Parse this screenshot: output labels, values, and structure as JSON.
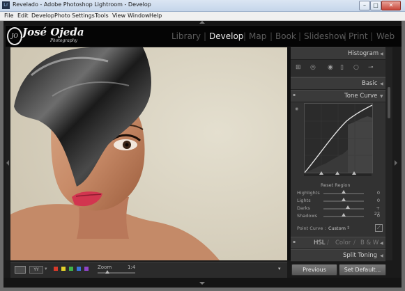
{
  "window": {
    "app_icon": "Lr",
    "title": "Revelado - Adobe Photoshop Lightroom - Develop",
    "minimize_glyph": "–",
    "maximize_glyph": "□",
    "close_glyph": "✕"
  },
  "menu": [
    {
      "key": "file",
      "label": "File"
    },
    {
      "key": "edit",
      "label": "Edit"
    },
    {
      "key": "develop",
      "label": "Develop"
    },
    {
      "key": "photo",
      "label": "Photo"
    },
    {
      "key": "settings",
      "label": "Settings"
    },
    {
      "key": "tools",
      "label": "Tools"
    },
    {
      "key": "view",
      "label": "View"
    },
    {
      "key": "window",
      "label": "Window"
    },
    {
      "key": "help",
      "label": "Help"
    }
  ],
  "identity": {
    "monogram": "JO",
    "name": "José Ojeda",
    "subtitle": "Photography"
  },
  "modules": [
    {
      "key": "library",
      "label": "Library",
      "active": false
    },
    {
      "key": "develop",
      "label": "Develop",
      "active": true
    },
    {
      "key": "map",
      "label": "Map",
      "active": false
    },
    {
      "key": "book",
      "label": "Book",
      "active": false
    },
    {
      "key": "slideshow",
      "label": "Slideshow",
      "active": false
    },
    {
      "key": "print",
      "label": "Print",
      "active": false
    },
    {
      "key": "web",
      "label": "Web",
      "active": false
    }
  ],
  "module_separator": "|",
  "panels": {
    "histogram": "Histogram",
    "basic": "Basic",
    "tone_curve": "Tone Curve",
    "hsl": "HSL",
    "color": "Color",
    "bw": "B & W",
    "split_toning": "Split Toning",
    "hsl_separator": "/"
  },
  "tone_curve": {
    "reset_region": "Reset Region",
    "sliders": [
      {
        "key": "highlights",
        "label": "Highlights",
        "value": "0",
        "position": 0.5
      },
      {
        "key": "lights",
        "label": "Lights",
        "value": "0",
        "position": 0.5
      },
      {
        "key": "darks",
        "label": "Darks",
        "value": "+ 22",
        "position": 0.61
      },
      {
        "key": "shadows",
        "label": "Shadows",
        "value": "0",
        "position": 0.5
      }
    ],
    "point_curve_label": "Point Curve :",
    "point_curve_value": "Custom",
    "point_curve_arrows": "⇕"
  },
  "toolbar": {
    "compare_label": "YY",
    "zoom_label": "Zoom",
    "zoom_value": "1:4",
    "zoom_position": 0.25,
    "color_labels": [
      "#d83a2a",
      "#e3d12a",
      "#3fb24a",
      "#3a73d8",
      "#8f44c7"
    ]
  },
  "buttons": {
    "previous": "Previous",
    "set_default": "Set Default..."
  },
  "colors": {
    "panel_bg": "#323232",
    "canvas_bg": "#d9d3c2",
    "identity_bg": "#050505",
    "active_module": "#e8e8e8",
    "inactive_module": "#5c5c5c"
  },
  "icons": {
    "window_triangle": "triangle-icon",
    "panel_collapse": "triangle-left-icon",
    "panel_expand": "triangle-down-icon"
  }
}
